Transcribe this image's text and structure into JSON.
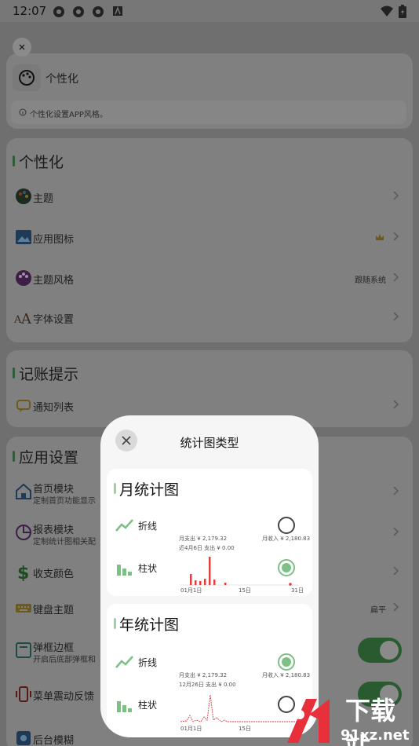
{
  "status_bar": {
    "time": "12:07"
  },
  "header": {
    "title": "个性化",
    "note": "个性化设置APP风格。"
  },
  "sections": {
    "personalize": {
      "title": "个性化",
      "items": [
        {
          "label": "主题",
          "right": ""
        },
        {
          "label": "应用图标",
          "right": ""
        },
        {
          "label": "主题风格",
          "right": "跟随系统"
        },
        {
          "label": "字体设置",
          "right": ""
        }
      ]
    },
    "reminder": {
      "title": "记账提示",
      "items": [
        {
          "label": "通知列表"
        }
      ]
    },
    "app": {
      "title": "应用设置",
      "items": [
        {
          "label": "首页模块",
          "sub": "定制首页功能显示"
        },
        {
          "label": "报表模块",
          "sub": "定制统计图相关配"
        },
        {
          "label": "收支颜色",
          "sub": ""
        },
        {
          "label": "键盘主题",
          "sub": "",
          "right": "扁平"
        },
        {
          "label": "弹框边框",
          "sub": "开启后底部弹框和"
        },
        {
          "label": "菜单震动反馈",
          "sub": ""
        },
        {
          "label": "后台模糊",
          "sub": ""
        }
      ]
    }
  },
  "modal": {
    "title": "统计图类型",
    "monthly": {
      "title": "月统计图",
      "options": [
        {
          "label": "折线",
          "selected": false
        },
        {
          "label": "柱状",
          "selected": true
        }
      ],
      "expense": "月支出 ¥ 2,179.32",
      "income": "月收入 ¥ 2,180.83",
      "note": "近4月6日 支出 ¥ 0.00",
      "x_ticks": [
        "01月1日",
        "15日",
        "31日"
      ]
    },
    "yearly": {
      "title": "年统计图",
      "options": [
        {
          "label": "折线",
          "selected": true
        },
        {
          "label": "柱状",
          "selected": false
        }
      ],
      "expense": "月支出 ¥ 2,179.32",
      "income": "月收入 ¥ 2,180.83",
      "note": "12月26日 支出 ¥ 0.00",
      "x_ticks": [
        "01月1日",
        "15日"
      ]
    }
  },
  "watermark": {
    "brand": "下载站",
    "domain": "91xz.net"
  }
}
